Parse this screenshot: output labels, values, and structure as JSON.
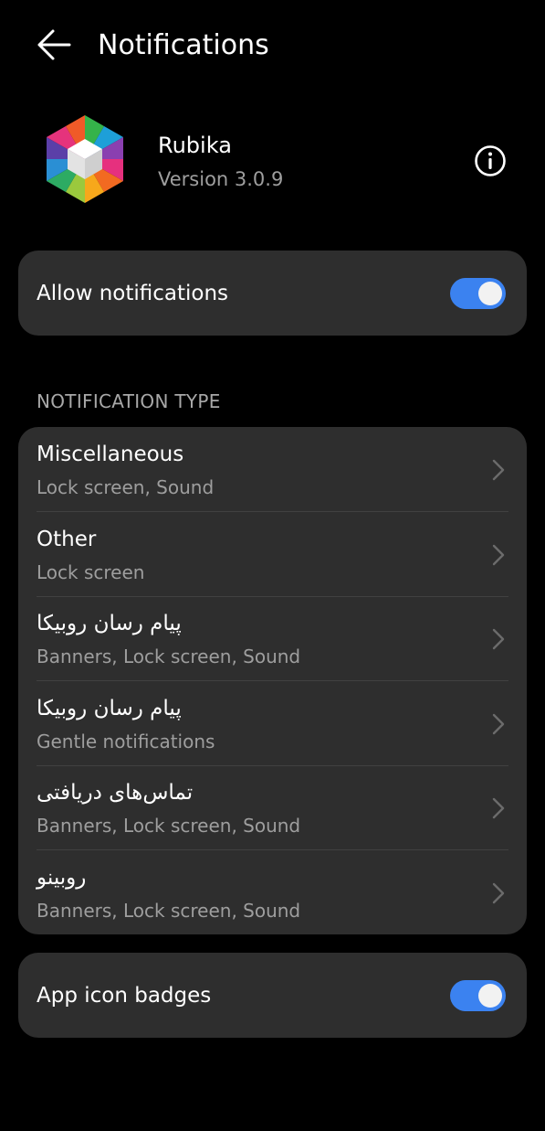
{
  "header": {
    "title": "Notifications",
    "back_icon": "arrow-left-icon"
  },
  "app": {
    "name": "Rubika",
    "version": "Version 3.0.9",
    "info_icon": "info-icon"
  },
  "allow": {
    "label": "Allow notifications",
    "enabled": true
  },
  "notification_type": {
    "section_title": "NOTIFICATION TYPE",
    "items": [
      {
        "title": "Miscellaneous",
        "subtitle": "Lock screen, Sound"
      },
      {
        "title": "Other",
        "subtitle": "Lock screen"
      },
      {
        "title": "پیام رسان روبیکا",
        "subtitle": "Banners, Lock screen, Sound"
      },
      {
        "title": "پیام رسان روبیکا",
        "subtitle": "Gentle notifications"
      },
      {
        "title": "تماس‌های دریافتی",
        "subtitle": "Banners, Lock screen, Sound"
      },
      {
        "title": "روبینو",
        "subtitle": "Banners, Lock screen, Sound"
      }
    ]
  },
  "badges": {
    "label": "App icon badges",
    "enabled": true
  },
  "colors": {
    "background": "#000000",
    "card": "#2e2e2e",
    "accent": "#3b82f0",
    "secondary_text": "#9e9e9e"
  }
}
